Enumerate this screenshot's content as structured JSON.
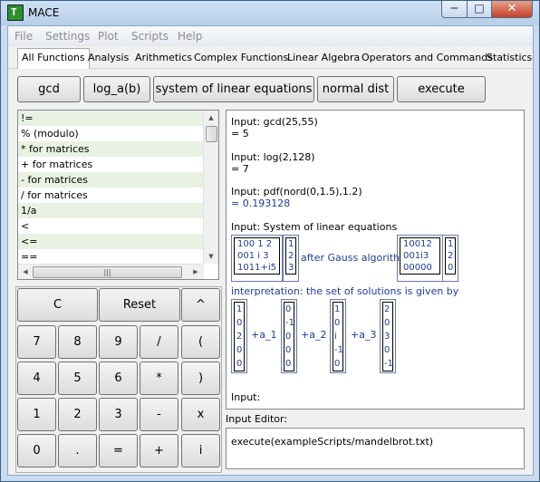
{
  "window": {
    "title": "MACE",
    "app_icon_glyph": "T"
  },
  "menu": [
    "File",
    "Settings",
    "Plot",
    "Scripts",
    "Help"
  ],
  "tabs": [
    "All Functions",
    "Analysis",
    "Arithmetics",
    "Complex Functions",
    "Linear Algebra",
    "Operators and Commands",
    "Statistics"
  ],
  "toolbar_buttons": [
    "gcd",
    "log_a(b)",
    "system of linear equations",
    "normal dist",
    "execute"
  ],
  "operator_list": [
    "!=",
    "% (modulo)",
    "* for matrices",
    "+ for matrices",
    "- for matrices",
    "/ for matrices",
    "1/a",
    "<",
    "<=",
    "=="
  ],
  "keypad": {
    "top": [
      "C",
      "Reset",
      "^"
    ],
    "row1": [
      "7",
      "8",
      "9",
      "/",
      "("
    ],
    "row2": [
      "4",
      "5",
      "6",
      "*",
      ")"
    ],
    "row3": [
      "1",
      "2",
      "3",
      "-",
      "x"
    ],
    "row4": [
      "0",
      ".",
      "=",
      "+",
      "i"
    ]
  },
  "output": {
    "gcd_input": "Input: gcd(25,55)",
    "gcd_result": "= 5",
    "log_input": "Input: log(2,128)",
    "log_result": "= 7",
    "pdf_input": "Input: pdf(nord(0,1.5),1.2)",
    "pdf_result": "= 0.193128",
    "sle_input": "Input: System of linear equations",
    "matrix_a": [
      "100  1  2",
      "001  i  3",
      "1011+i5"
    ],
    "vector_b": [
      "1",
      "2",
      "3"
    ],
    "after_gauss": "after Gauss algorithm",
    "matrix_reduced": [
      "10012",
      "001i3",
      "00000"
    ],
    "vector_reduced": [
      "1",
      "2",
      "0"
    ],
    "interpretation": "interpretation: the set of solutions is given by",
    "solution_vectors": [
      [
        "1",
        "0",
        "2",
        "0",
        "0"
      ],
      [
        "0",
        "-1",
        "0",
        "0",
        "0"
      ],
      [
        "1",
        "0",
        "i",
        "-1",
        "0"
      ],
      [
        "2",
        "0",
        "3",
        "0",
        "-1"
      ]
    ],
    "coefficients": [
      "+a_1",
      "+a_2",
      "+a_3"
    ],
    "empty_input": "Input:"
  },
  "editor": {
    "label": "Input Editor:",
    "value": "execute(exampleScripts/mandelbrot.txt)"
  }
}
